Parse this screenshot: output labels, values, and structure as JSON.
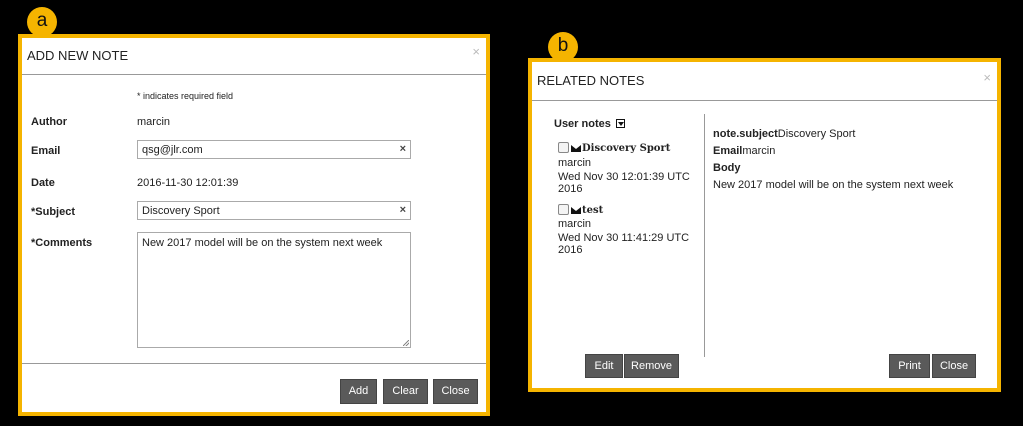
{
  "badges": {
    "a": "a",
    "b": "b"
  },
  "add_note": {
    "title": "ADD NEW NOTE",
    "close_glyph": "×",
    "required_hint": "* indicates required field",
    "author_label": "Author",
    "author_value": "marcin",
    "email_label": "Email",
    "email_value": "qsg@jlr.com",
    "date_label": "Date",
    "date_value": "2016-11-30 12:01:39",
    "subject_label": "*Subject",
    "subject_value": "Discovery Sport",
    "comments_label": "*Comments",
    "comments_value": "New 2017 model will be on the system next week",
    "clear_glyph": "×",
    "buttons": {
      "add": "Add",
      "clear": "Clear",
      "close": "Close"
    }
  },
  "related_notes": {
    "title": "RELATED NOTES",
    "close_glyph": "×",
    "user_notes_label": "User notes",
    "notes": [
      {
        "subject": "Discovery Sport",
        "author": "marcin",
        "date_line1": "Wed Nov 30 12:01:39 UTC",
        "date_line2": "2016"
      },
      {
        "subject": "test",
        "author": "marcin",
        "date_line1": "Wed Nov 30 11:41:29 UTC",
        "date_line2": "2016"
      }
    ],
    "detail": {
      "subject_key": "note.subject",
      "subject_value": "Discovery Sport",
      "email_key": "Email",
      "email_value": "marcin",
      "body_key": "Body",
      "body_value": "New 2017 model will be on the system next week"
    },
    "buttons": {
      "edit": "Edit",
      "remove": "Remove",
      "print": "Print",
      "close": "Close"
    }
  }
}
